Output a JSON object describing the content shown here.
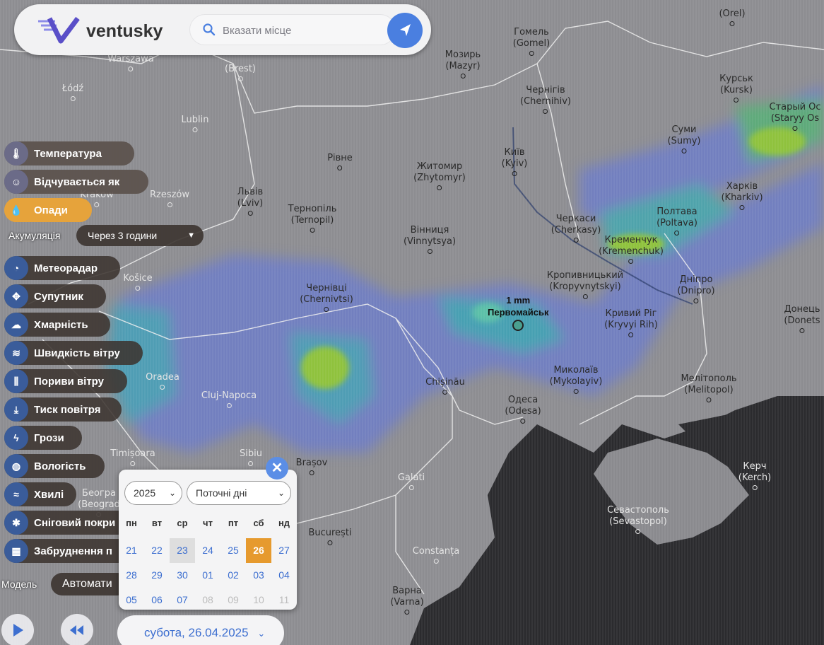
{
  "app": {
    "brand": "ventusky",
    "search_placeholder": "Вказати місце"
  },
  "layers": [
    {
      "label": "Температура",
      "icon": "thermometer-icon",
      "active": false
    },
    {
      "label": "Відчувається як",
      "icon": "feels-like-icon",
      "active": false
    },
    {
      "label": "Опади",
      "icon": "raindrop-icon",
      "active": true
    },
    {
      "label": "Метеорадар",
      "icon": "radar-icon",
      "active": false
    },
    {
      "label": "Супутник",
      "icon": "satellite-icon",
      "active": false
    },
    {
      "label": "Хмарність",
      "icon": "cloud-icon",
      "active": false
    },
    {
      "label": "Швидкість вітру",
      "icon": "wind-icon",
      "active": false
    },
    {
      "label": "Пориви вітру",
      "icon": "wind-gust-icon",
      "active": false
    },
    {
      "label": "Тиск повітря",
      "icon": "pressure-icon",
      "active": false
    },
    {
      "label": "Грози",
      "icon": "lightning-icon",
      "active": false
    },
    {
      "label": "Вологість",
      "icon": "humidity-icon",
      "active": false
    },
    {
      "label": "Хвилі",
      "icon": "waves-icon",
      "active": false
    },
    {
      "label": "Сніговий покри",
      "icon": "snowflake-icon",
      "active": false
    },
    {
      "label": "Забруднення п",
      "icon": "pollution-icon",
      "active": false
    }
  ],
  "accumulation": {
    "label": "Акумуляція",
    "value": "Через 3 години"
  },
  "model": {
    "label": "Модель",
    "value": "Автомати"
  },
  "marker": {
    "value": "1 mm",
    "place": "Первомайськ"
  },
  "calendar": {
    "year": "2025",
    "period": "Поточні дні",
    "weekdays": [
      "пн",
      "вт",
      "ср",
      "чт",
      "пт",
      "сб",
      "нд"
    ],
    "weeks": [
      [
        "21",
        "22",
        "23",
        "24",
        "25",
        "26",
        "27"
      ],
      [
        "28",
        "29",
        "30",
        "01",
        "02",
        "03",
        "04"
      ],
      [
        "05",
        "06",
        "07",
        "08",
        "09",
        "10",
        "11"
      ]
    ],
    "selected": "26",
    "close": "✕"
  },
  "date_display": "субота, 26.04.2025",
  "cities": [
    {
      "name": "Warszawa",
      "alt": ""
    },
    {
      "name": "(Brest)",
      "alt": ""
    },
    {
      "name": "Łódź",
      "alt": ""
    },
    {
      "name": "Lublin",
      "alt": ""
    },
    {
      "name": "Мозирь",
      "alt": "(Mazyr)"
    },
    {
      "name": "Гомель",
      "alt": "(Gomel)"
    },
    {
      "name": "Чернігів",
      "alt": "(Chernihiv)"
    },
    {
      "name": "Курськ",
      "alt": "(Kursk)"
    },
    {
      "name": "(Orel)",
      "alt": ""
    },
    {
      "name": "Старый Ос",
      "alt": "(Staryy Os"
    },
    {
      "name": "Суми",
      "alt": "(Sumy)"
    },
    {
      "name": "Рівне",
      "alt": ""
    },
    {
      "name": "Житомир",
      "alt": "(Zhytomyr)"
    },
    {
      "name": "Київ",
      "alt": "(Kyiv)"
    },
    {
      "name": "Харків",
      "alt": "(Kharkiv)"
    },
    {
      "name": "Rzeszów",
      "alt": ""
    },
    {
      "name": "Львів",
      "alt": "(Lviv)"
    },
    {
      "name": "Тернопіль",
      "alt": "(Ternopil)"
    },
    {
      "name": "Вінниця",
      "alt": "(Vinnytsya)"
    },
    {
      "name": "Черкаси",
      "alt": "(Cherkasy)"
    },
    {
      "name": "Полтава",
      "alt": "(Poltava)"
    },
    {
      "name": "Кременчук",
      "alt": "(Kremenchuk)"
    },
    {
      "name": "Krakow",
      "alt": ""
    },
    {
      "name": "Košice",
      "alt": ""
    },
    {
      "name": "Чернівці",
      "alt": "(Chernivtsi)"
    },
    {
      "name": "Кропивницький",
      "alt": "(Kropyvnytskyi)"
    },
    {
      "name": "Дніпро",
      "alt": "(Dnipro)"
    },
    {
      "name": "Кривий Ріг",
      "alt": "(Kryvyi Rih)"
    },
    {
      "name": "Донець",
      "alt": "(Donets"
    },
    {
      "name": "Oradea",
      "alt": ""
    },
    {
      "name": "Cluj-Napoca",
      "alt": ""
    },
    {
      "name": "Chișinău",
      "alt": ""
    },
    {
      "name": "Миколаїв",
      "alt": "(Mykolayiv)"
    },
    {
      "name": "Мелітополь",
      "alt": "(Melitopol)"
    },
    {
      "name": "Одеса",
      "alt": "(Odesa)"
    },
    {
      "name": "Timișoara",
      "alt": ""
    },
    {
      "name": "Sibiu",
      "alt": ""
    },
    {
      "name": "Brașov",
      "alt": ""
    },
    {
      "name": "Galati",
      "alt": ""
    },
    {
      "name": "Керч",
      "alt": "(Kerch)"
    },
    {
      "name": "Београ",
      "alt": "(Beograd"
    },
    {
      "name": "Севастополь",
      "alt": "(Sevastopol)"
    },
    {
      "name": "București",
      "alt": ""
    },
    {
      "name": "Constanța",
      "alt": ""
    },
    {
      "name": "Варна",
      "alt": "(Varna)"
    }
  ],
  "colors": {
    "accent": "#e6a33b",
    "button_blue": "#4a7fe0",
    "link_blue": "#3d6fd0",
    "land": "#8c8c90",
    "sea": "#2b2b2e",
    "precip_light": "#7d8ac8",
    "precip_mid": "#4a9fb8",
    "precip_high": "#8fc23e"
  }
}
